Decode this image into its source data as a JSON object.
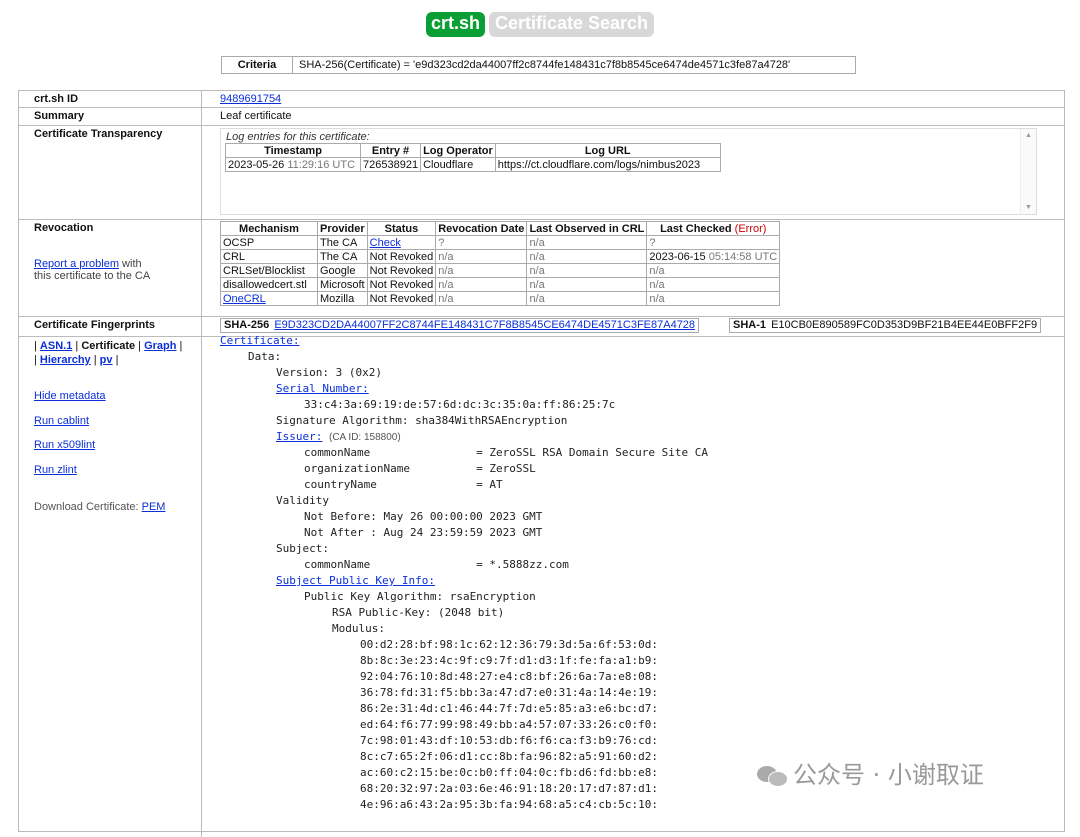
{
  "header": {
    "logo": "crt.sh",
    "subtitle": "Certificate Search"
  },
  "criteria": {
    "label": "Criteria",
    "value": "SHA-256(Certificate) = 'e9d323cd2da44007ff2c8744fe148431c7f8b8545ce6474de4571c3fe87a4728'"
  },
  "rows": {
    "id": {
      "label": "crt.sh ID",
      "value": "9489691754"
    },
    "summary": {
      "label": "Summary",
      "value": "Leaf certificate"
    },
    "ct": {
      "label": "Certificate Transparency",
      "caption": "Log entries for this certificate:",
      "headers": [
        "Timestamp",
        "Entry #",
        "Log Operator",
        "Log URL"
      ],
      "entries": [
        {
          "date": "2023-05-26",
          "time": "11:29:16 UTC",
          "entry": "726538921",
          "operator": "Cloudflare",
          "url": "https://ct.cloudflare.com/logs/nimbus2023"
        }
      ]
    },
    "revocation": {
      "label": "Revocation",
      "report_link": "Report a problem",
      "report_rest1": " with",
      "report_rest2": "this certificate to the CA",
      "headers": [
        "Mechanism",
        "Provider",
        "Status",
        "Revocation Date",
        "Last Observed in CRL",
        "Last Checked"
      ],
      "error_label": "(Error)",
      "rows": [
        {
          "mechanism": "OCSP",
          "provider": "The CA",
          "status": "Check",
          "rev_date": "?",
          "observed": "n/a",
          "checked": "?"
        },
        {
          "mechanism": "CRL",
          "provider": "The CA",
          "status": "Not Revoked",
          "rev_date": "n/a",
          "observed": "n/a",
          "checked": "2023-06-15",
          "checked_time": "05:14:58 UTC"
        },
        {
          "mechanism": "CRLSet/Blocklist",
          "provider": "Google",
          "status": "Not Revoked",
          "rev_date": "n/a",
          "observed": "n/a",
          "checked": "n/a"
        },
        {
          "mechanism": "disallowedcert.stl",
          "provider": "Microsoft",
          "status": "Not Revoked",
          "rev_date": "n/a",
          "observed": "n/a",
          "checked": "n/a"
        },
        {
          "mechanism": "OneCRL",
          "provider": "Mozilla",
          "status": "Not Revoked",
          "rev_date": "n/a",
          "observed": "n/a",
          "checked": "n/a"
        }
      ]
    },
    "fingerprints": {
      "label": "Certificate Fingerprints",
      "sha256_label": "SHA-256",
      "sha256": "E9D323CD2DA44007FF2C8744FE148431C7F8B8545CE6474DE4571C3FE87A4728",
      "sha1_label": "SHA-1",
      "sha1": "E10CB0E890589FC0D353D9BF21B4EE44E0BFF2F9"
    }
  },
  "nav": {
    "asn1": "ASN.1",
    "certificate": "Certificate",
    "graph": "Graph",
    "hierarchy": "Hierarchy",
    "pv": "pv",
    "hide_metadata": "Hide metadata",
    "cablint": "Run cablint",
    "x509lint": "Run x509lint",
    "zlint": "Run zlint",
    "download_label": "Download Certificate: ",
    "pem": "PEM"
  },
  "cert": {
    "certificate": "Certificate:",
    "data": "Data:",
    "version": "Version: 3 (0x2)",
    "serial_label": "Serial Number:",
    "serial": "33:c4:3a:69:19:de:57:6d:dc:3c:35:0a:ff:86:25:7c",
    "sig_alg": "Signature Algorithm: sha384WithRSAEncryption",
    "issuer_label": "Issuer:",
    "issuer_caid": "(CA ID: 158800)",
    "issuer_cn": "commonName                = ZeroSSL RSA Domain Secure Site CA",
    "issuer_o": "organizationName          = ZeroSSL",
    "issuer_c": "countryName               = AT",
    "validity": "Validity",
    "not_before": "Not Before: May 26 00:00:00 2023 GMT",
    "not_after": "Not After : Aug 24 23:59:59 2023 GMT",
    "subject": "Subject:",
    "subject_cn": "commonName                = *.5888zz.com",
    "spki_label": "Subject Public Key Info:",
    "pk_alg": "Public Key Algorithm: rsaEncryption",
    "rsa_key": "RSA Public-Key: (2048 bit)",
    "modulus": "Modulus:",
    "modulus_lines": [
      "00:d2:28:bf:98:1c:62:12:36:79:3d:5a:6f:53:0d:",
      "8b:8c:3e:23:4c:9f:c9:7f:d1:d3:1f:fe:fa:a1:b9:",
      "92:04:76:10:8d:48:27:e4:c8:bf:26:6a:7a:e8:08:",
      "36:78:fd:31:f5:bb:3a:47:d7:e0:31:4a:14:4e:19:",
      "86:2e:31:4d:c1:46:44:7f:7d:e5:85:a3:e6:bc:d7:",
      "ed:64:f6:77:99:98:49:bb:a4:57:07:33:26:c0:f0:",
      "7c:98:01:43:df:10:53:db:f6:f6:ca:f3:b9:76:cd:",
      "8c:c7:65:2f:06:d1:cc:8b:fa:96:82:a5:91:60:d2:",
      "ac:60:c2:15:be:0c:b0:ff:04:0c:fb:d6:fd:bb:e8:",
      "68:20:32:97:2a:03:6e:46:91:18:20:17:d7:87:d1:",
      "4e:96:a6:43:2a:95:3b:fa:94:68:a5:c4:cb:5c:10:"
    ]
  },
  "watermark": "公众号 · 小谢取证"
}
